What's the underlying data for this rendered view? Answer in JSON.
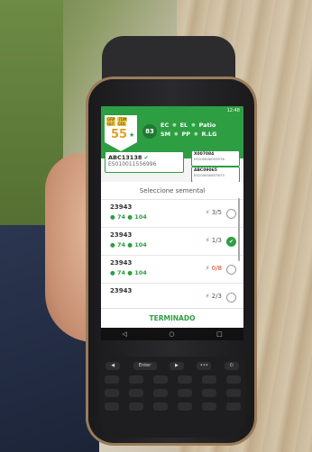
{
  "status_bar": {
    "time": "12:48"
  },
  "badge": {
    "tag1": "GRP",
    "tag2": "7DM",
    "tag3": "GLF",
    "tag4": "GOL",
    "number": "55",
    "star": "★"
  },
  "score_circle": "83",
  "codes": {
    "r1": [
      "EC",
      "EL",
      "Patio"
    ],
    "r2": [
      "SM",
      "PP",
      "R.LG"
    ]
  },
  "animal": {
    "id": "ABC13138",
    "code": "ES010011556996"
  },
  "side_cards": [
    {
      "id": "X007084",
      "code": "ES100000053576"
    },
    {
      "id": "ABC09065",
      "code": "ES100000857673"
    }
  ],
  "panel": {
    "title": "Seleccione semental",
    "rows": [
      {
        "id": "23943",
        "v1": "74",
        "v2": "104",
        "score": "3/5",
        "selected": false,
        "red": false
      },
      {
        "id": "23943",
        "v1": "74",
        "v2": "104",
        "score": "1/3",
        "selected": true,
        "red": false
      },
      {
        "id": "23943",
        "v1": "74",
        "v2": "104",
        "score": "0/8",
        "selected": false,
        "red": true
      },
      {
        "id": "23943",
        "v1": "",
        "v2": "",
        "score": "2/3",
        "selected": false,
        "red": false
      }
    ]
  },
  "terminado": "TERMINADO",
  "navbar": [
    "◁",
    "○",
    "□"
  ],
  "keyboard": {
    "enter": "Enter"
  },
  "colors": {
    "accent": "#2e9e43",
    "warning": "#e03a2a"
  }
}
